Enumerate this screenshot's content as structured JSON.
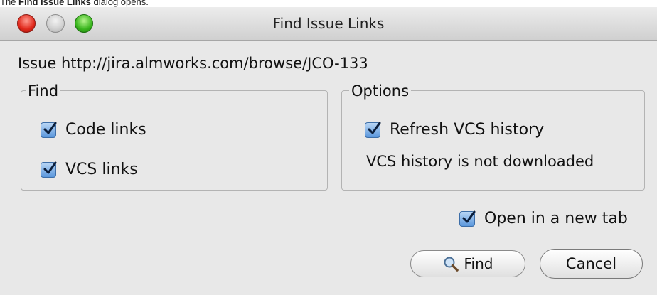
{
  "caption": {
    "prefix": "The ",
    "bold": "Find Issue Links",
    "suffix": " dialog opens."
  },
  "window": {
    "title": "Find Issue Links"
  },
  "issue_label": "Issue http://jira.almworks.com/browse/JCO-133",
  "find_group": {
    "legend": "Find",
    "code_links": {
      "label": "Code links",
      "checked": true
    },
    "vcs_links": {
      "label": "VCS links",
      "checked": true
    }
  },
  "options_group": {
    "legend": "Options",
    "refresh_vcs": {
      "label": "Refresh VCS history",
      "checked": true
    },
    "status_text": "VCS history is not downloaded"
  },
  "open_new_tab": {
    "label": "Open in a new tab",
    "checked": true
  },
  "buttons": {
    "find": "Find",
    "cancel": "Cancel"
  },
  "icons": {
    "find_button_icon": "magnifier-icon",
    "checkbox_icon": "checkmark-icon"
  },
  "colors": {
    "checkbox_accent": "#5b97dc",
    "close_light": "#e0281b",
    "zoom_light": "#39b51d"
  }
}
